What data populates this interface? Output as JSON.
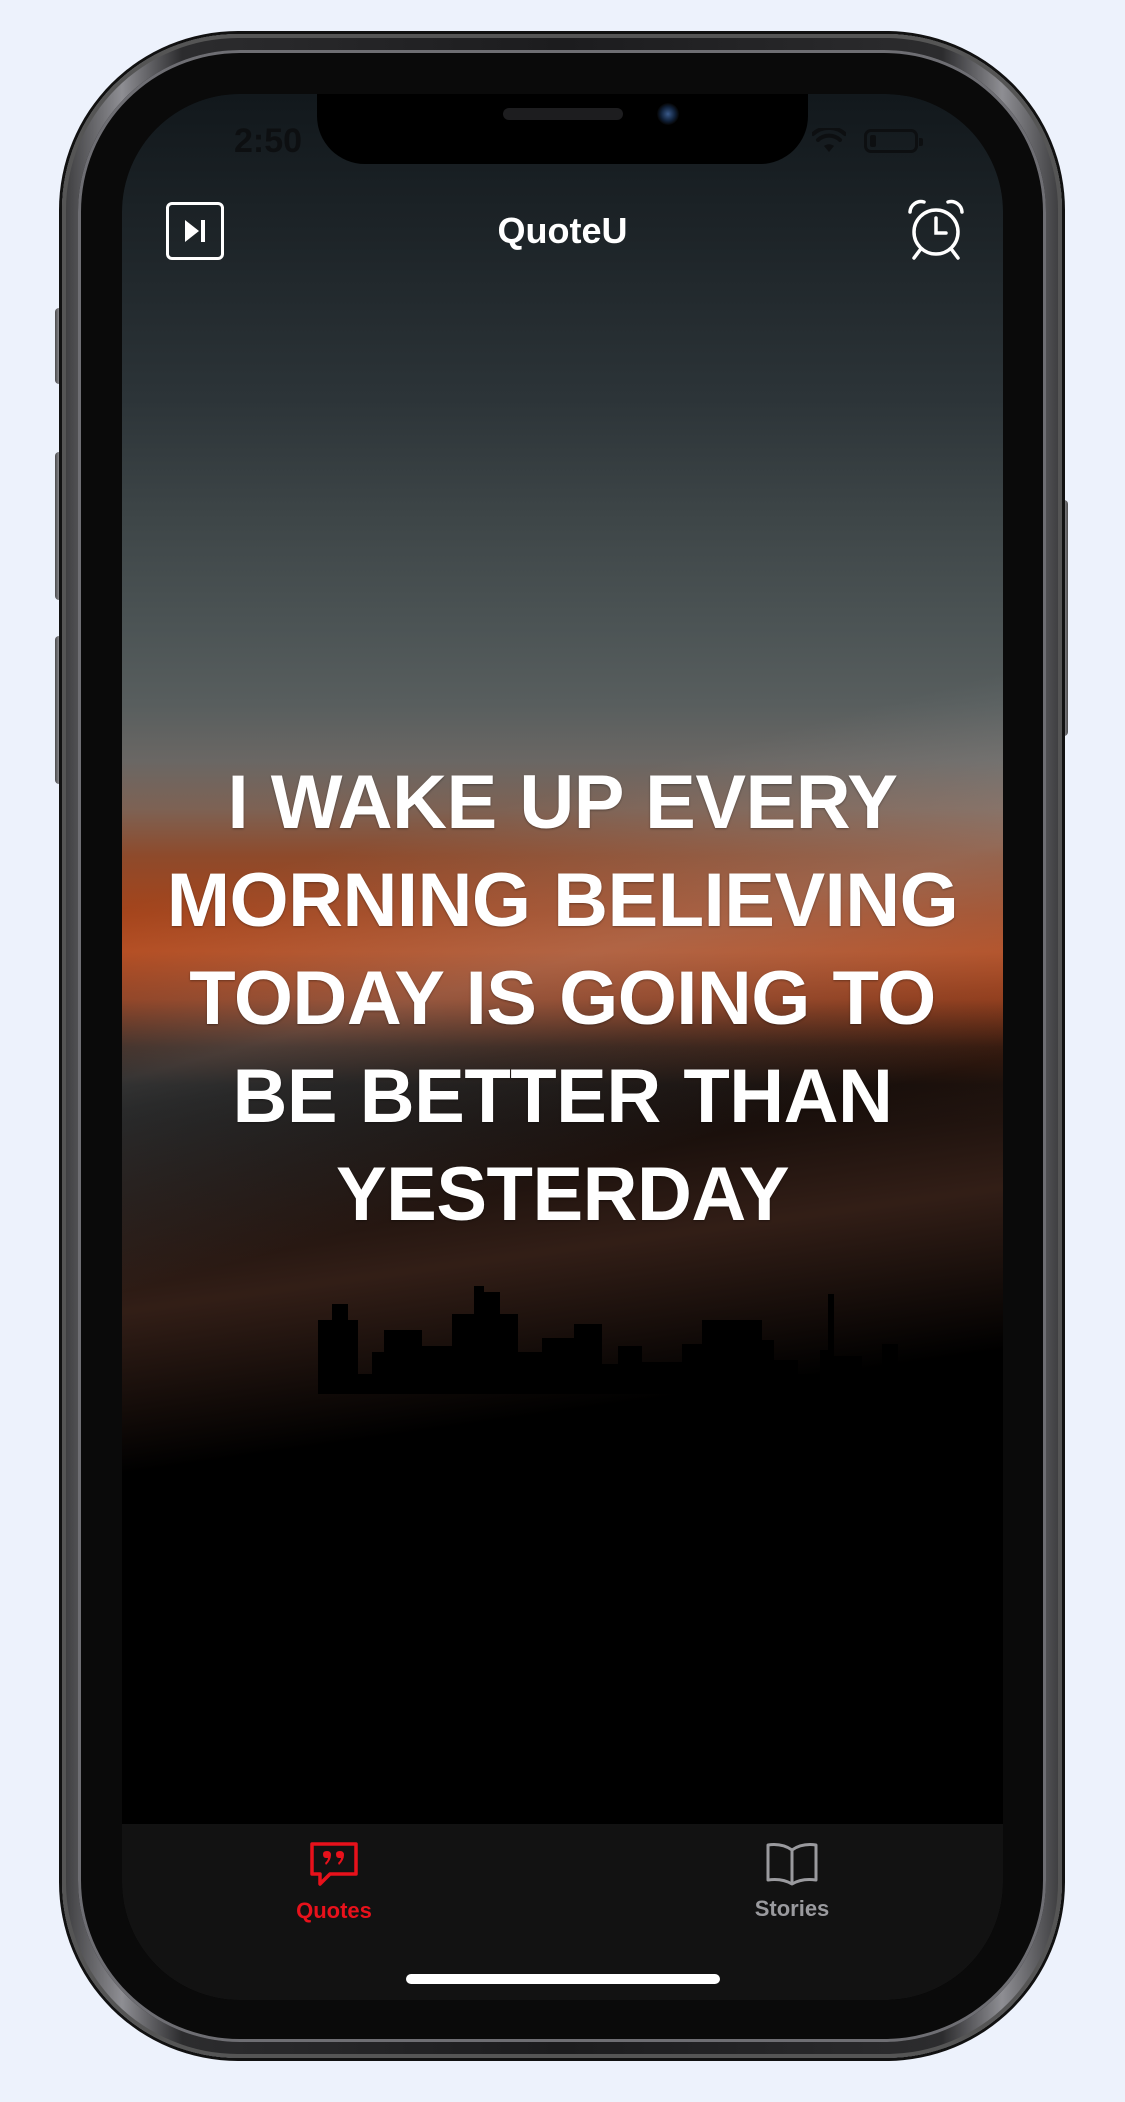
{
  "status_bar": {
    "time": "2:50",
    "wifi_icon": "wifi-icon",
    "battery_icon": "battery-icon",
    "battery_level": 0.15
  },
  "header": {
    "title": "QuoteU",
    "left_icon": "skip-forward-icon",
    "right_icon": "alarm-clock-icon"
  },
  "quote": {
    "text": "I WAKE UP EVERY MORNING BELIEVING TODAY IS GOING TO BE BETTER THAN YESTERDAY"
  },
  "tab_bar": {
    "active_color": "#e8111b",
    "inactive_color": "#9a9a9e",
    "tabs": [
      {
        "label": "Quotes",
        "icon": "quote-bubble-icon",
        "active": true
      },
      {
        "label": "Stories",
        "icon": "open-book-icon",
        "active": false
      }
    ]
  }
}
